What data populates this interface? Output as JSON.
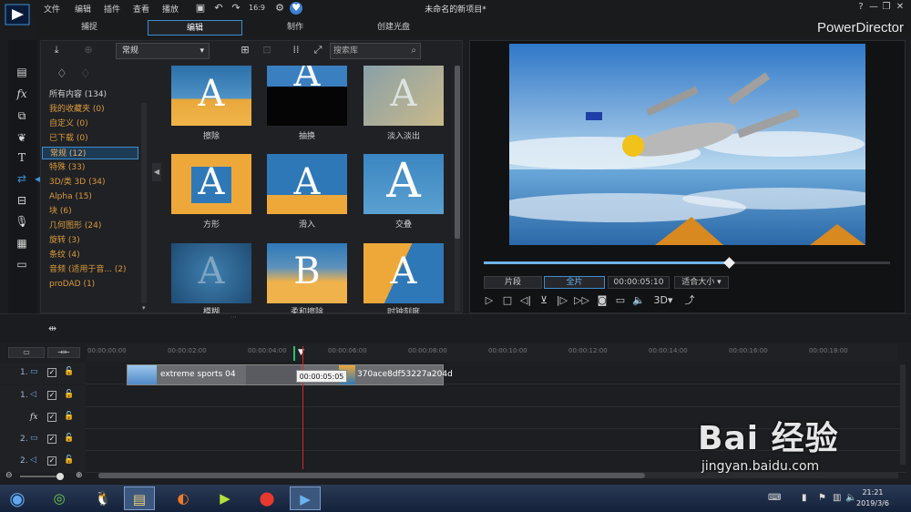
{
  "menu": [
    "文件",
    "编辑",
    "插件",
    "查看",
    "播放"
  ],
  "app_title": "未命名的新项目*",
  "window_buttons": [
    "?",
    "—",
    "❐",
    "✕"
  ],
  "toolbar_icons": [
    "save-icon",
    "undo-icon",
    "redo-icon",
    "resolution-icon",
    "settings-icon",
    "notification-icon"
  ],
  "tabs": [
    "捕捉",
    "编辑",
    "制作",
    "创建光盘"
  ],
  "active_tab": "编辑",
  "brand": "PowerDirector",
  "library": {
    "combo_value": "常规",
    "search_placeholder": "搜索库",
    "categories": [
      {
        "label": "所有内容 (134)"
      },
      {
        "label": "我的收藏夹 (0)"
      },
      {
        "label": "自定义 (0)"
      },
      {
        "label": "已下载 (0)"
      },
      {
        "label": "常规 (12)"
      },
      {
        "label": "特殊 (33)"
      },
      {
        "label": "3D/类 3D (34)"
      },
      {
        "label": "Alpha (15)"
      },
      {
        "label": "块 (6)"
      },
      {
        "label": "几何图形 (24)"
      },
      {
        "label": "旋转 (3)"
      },
      {
        "label": "条纹 (4)"
      },
      {
        "label": "音频 (适用于音... (2)"
      },
      {
        "label": "proDAD (1)"
      }
    ],
    "selected_category": "常规 (12)",
    "transitions": [
      "擦除",
      "抽换",
      "淡入淡出",
      "方形",
      "滑入",
      "交叠",
      "模糊",
      "柔和擦除",
      "时钟刻度"
    ]
  },
  "preview": {
    "mode_clip": "片段",
    "mode_movie": "全片",
    "timecode": "00:00:05:10",
    "fit": "适合大小",
    "scrub_position": 0.6,
    "three_d": "3D"
  },
  "timeline": {
    "ruler": [
      "00:00:00:00",
      "00:00:02:00",
      "00:00:04:00",
      "00:00:06:00",
      "00:00:08:00",
      "00:00:10:00",
      "00:00:12:00",
      "00:00:14:00",
      "00:00:16:00",
      "00:00:18:00"
    ],
    "tracks": [
      "1.",
      "1.",
      "fx",
      "2.",
      "2."
    ],
    "clip1_title": "extreme sports 04",
    "clip2_title": "370ace8df53227a204d",
    "tooltip": "00:00:05:05"
  },
  "taskbar": {
    "time": "21:21",
    "date": "2019/3/6"
  },
  "watermark": {
    "text": "Bai 经验",
    "url": "jingyan.baidu.com"
  },
  "colors": {
    "accent": "#3d8fd0",
    "category": "#d99a3c",
    "playhead": "#d02a2a"
  }
}
